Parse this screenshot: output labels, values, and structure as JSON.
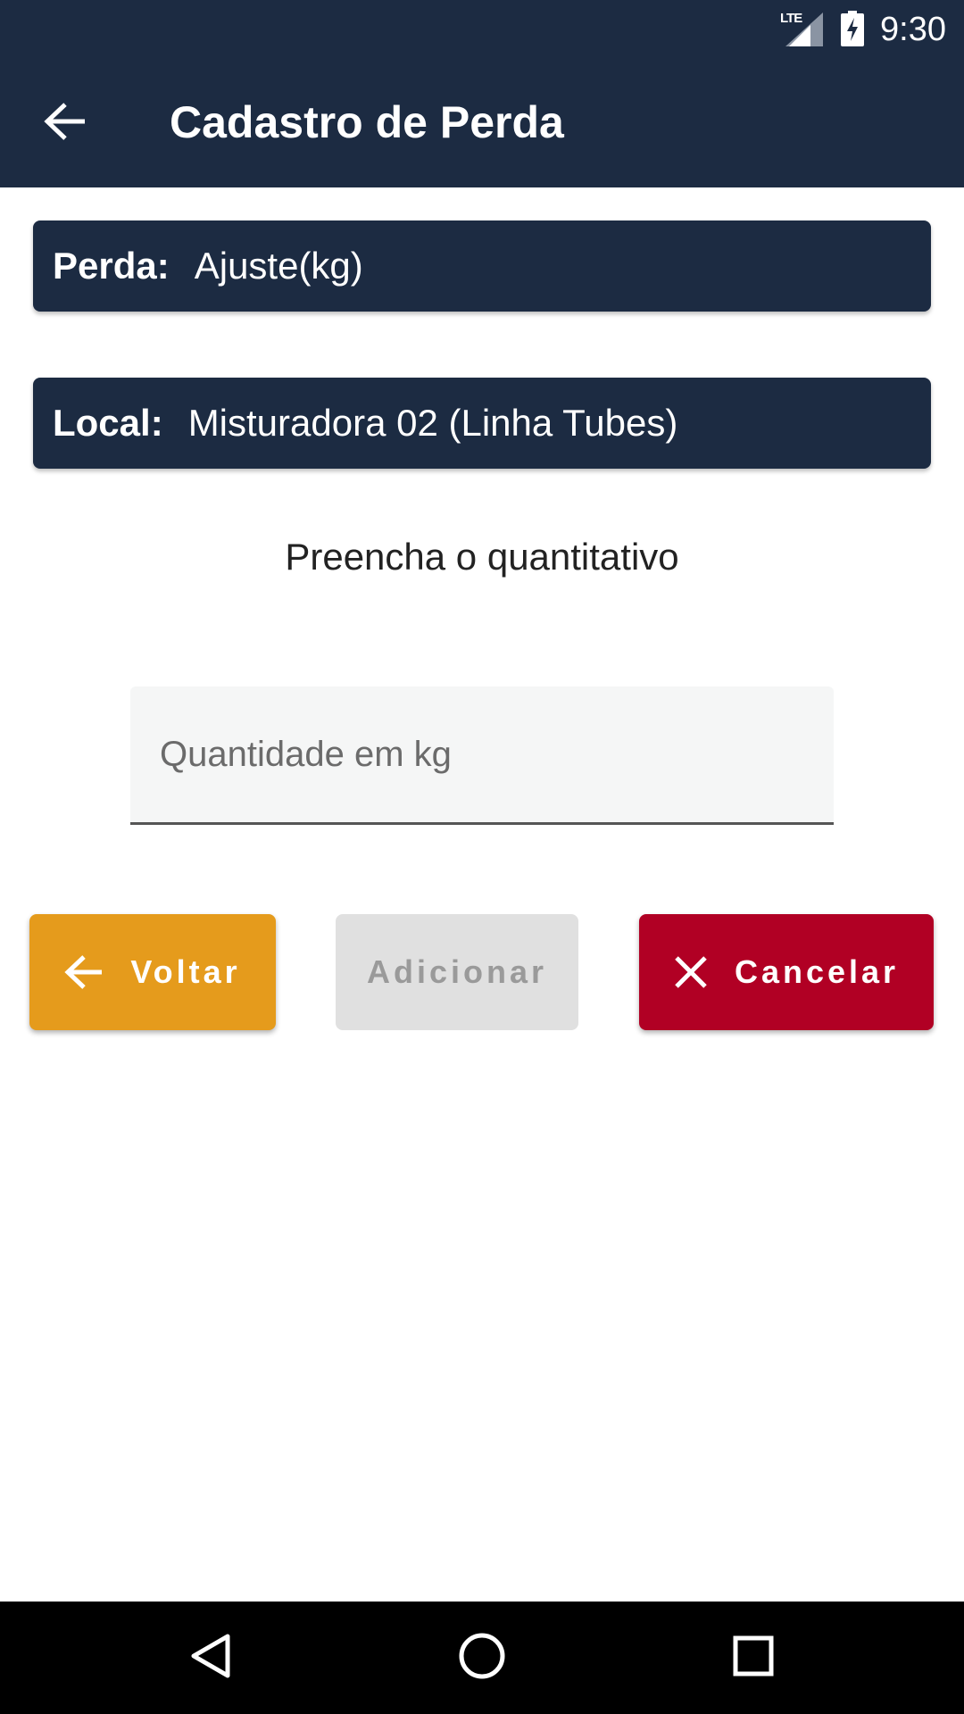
{
  "status_bar": {
    "network": "LTE",
    "time": "9:30",
    "icons": [
      "signal-icon",
      "battery-charging-icon"
    ]
  },
  "app_bar": {
    "title": "Cadastro de Perda",
    "back_icon": "arrow-left-icon"
  },
  "perda": {
    "label": "Perda:",
    "value": "Ajuste(kg)"
  },
  "local": {
    "label": "Local:",
    "value": "Misturadora 02 (Linha Tubes)"
  },
  "instruction": "Preencha o quantitativo",
  "quantity_input": {
    "value": "",
    "placeholder": "Quantidade em kg"
  },
  "buttons": {
    "voltar": {
      "label": "Voltar",
      "icon": "arrow-left-icon",
      "color": "#e59b1c"
    },
    "adicionar": {
      "label": "Adicionar",
      "state": "disabled",
      "color": "#e0e0e0"
    },
    "cancelar": {
      "label": "Cancelar",
      "icon": "close-icon",
      "color": "#b10024"
    }
  },
  "nav_bar": {
    "icons": [
      "nav-back-icon",
      "nav-home-icon",
      "nav-recents-icon"
    ]
  },
  "colors": {
    "primary": "#1c2b42",
    "background": "#ffffff"
  }
}
